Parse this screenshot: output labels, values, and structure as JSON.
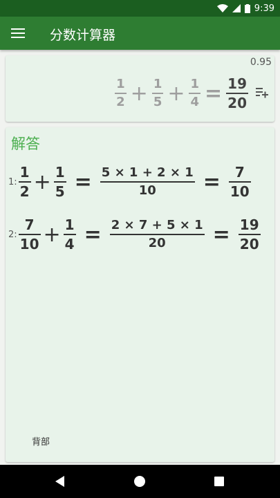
{
  "status": {
    "time": "9:39"
  },
  "app": {
    "title": "分数计算器"
  },
  "input": {
    "decimal": "0.95",
    "terms": [
      {
        "num": "1",
        "den": "2"
      },
      {
        "num": "1",
        "den": "5"
      },
      {
        "num": "1",
        "den": "4"
      }
    ],
    "ops": [
      "+",
      "+"
    ],
    "equals": "=",
    "result": {
      "num": "19",
      "den": "20"
    }
  },
  "solution": {
    "heading": "解答",
    "steps": [
      {
        "index": "1:",
        "a": {
          "num": "1",
          "den": "2"
        },
        "op": "+",
        "b": {
          "num": "1",
          "den": "5"
        },
        "eq1": "=",
        "mid": {
          "num": "5 × 1 + 2 × 1",
          "den": "10"
        },
        "eq2": "=",
        "result": {
          "num": "7",
          "den": "10"
        }
      },
      {
        "index": "2:",
        "a": {
          "num": "7",
          "den": "10"
        },
        "op": "+",
        "b": {
          "num": "1",
          "den": "4"
        },
        "eq1": "=",
        "mid": {
          "num": "2 × 7 + 5 × 1",
          "den": "20"
        },
        "eq2": "=",
        "result": {
          "num": "19",
          "den": "20"
        }
      }
    ],
    "back_label": "背部"
  }
}
